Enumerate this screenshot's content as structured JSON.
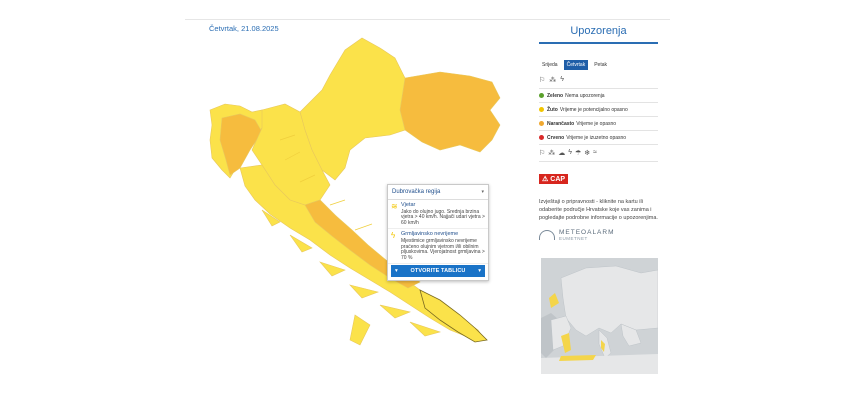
{
  "date": "Četvrtak, 21.08.2025",
  "panel": {
    "title": "Upozorenja",
    "tabs": [
      "Srijeda",
      "Četvrtak",
      "Petak"
    ],
    "active_tab": "Četvrtak",
    "legend": [
      {
        "label": "Zeleno",
        "text": "Nema upozorenja",
        "color": "#5aa02c"
      },
      {
        "label": "Žuto",
        "text": "Vrijeme je potencijalno opasno",
        "color": "#f2c500"
      },
      {
        "label": "Narančasto",
        "text": "Vrijeme je opasno",
        "color": "#f0a830"
      },
      {
        "label": "Crveno",
        "text": "Vrijeme je izuzetno opasno",
        "color": "#d92a2a"
      }
    ],
    "cap_label": "CAP",
    "info_text": "Izvještaji o pripravnosti - kliknite na kartu ili odaberite područje Hrvatske koje vas zanima i pogledajte podrobne informacije o upozorenjima.",
    "meteoalarm_title": "METEOALARM",
    "meteoalarm_sub": "EUMETNET"
  },
  "popup": {
    "region": "Dubrovačka regija",
    "items": [
      {
        "title": "Vjetar",
        "text": "Jako do olujno jugo. Srednja brzina vjetra > 40 km/h. Najjači udari vjetra > 60 km/h"
      },
      {
        "title": "Grmljavinsko nevrijeme",
        "text": "Mjestimice grmljavinsko nevrijeme praćeno olujnim vjetrom i/ili obilnim pljuskovima. Vjerojatnost grmljavina > 70 %"
      }
    ],
    "button": "OTVORITE TABLICU"
  },
  "colors": {
    "yellow": "#fbe24a",
    "orange": "#f6bc3e",
    "accent": "#1a73c7"
  }
}
